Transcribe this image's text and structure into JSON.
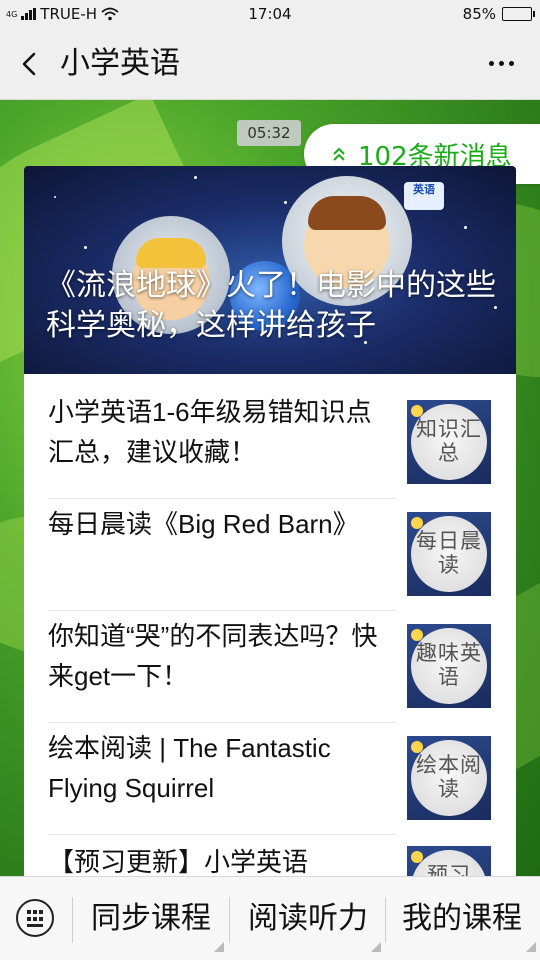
{
  "status_bar": {
    "network_small": "4G",
    "carrier": "TRUE-H",
    "time": "17:04",
    "battery_percent": "85%",
    "battery_level": 0.85,
    "battery_color": "#34c759"
  },
  "header": {
    "back_icon": "chevron-left-icon",
    "title": "小学英语",
    "more_icon": "more-dots-icon"
  },
  "chat": {
    "timestamp": "05:32",
    "new_messages_label": "102条新消息",
    "accent_color": "#1aad19"
  },
  "card": {
    "cover_title": "《流浪地球》火了！电影中的这些科学奥秘，这样讲给孩子",
    "cover_logo": "英语",
    "articles": [
      {
        "title": "小学英语1-6年级易错知识点汇总，建议收藏！",
        "thumb_text": "知识汇总"
      },
      {
        "title": "每日晨读《Big Red Barn》",
        "thumb_text": "每日晨读"
      },
      {
        "title": "你知道“哭”的不同表达吗？快来get一下！",
        "thumb_text": "趣味英语"
      },
      {
        "title": "绘本阅读 | The Fantastic Flying Squirrel",
        "thumb_text": "绘本阅读"
      },
      {
        "title": "【预习更新】小学英语",
        "thumb_text": "预习"
      }
    ]
  },
  "bottom_menu": {
    "keyboard_icon": "keyboard-icon",
    "items": [
      {
        "label": "同步课程"
      },
      {
        "label": "阅读听力"
      },
      {
        "label": "我的课程"
      }
    ]
  }
}
